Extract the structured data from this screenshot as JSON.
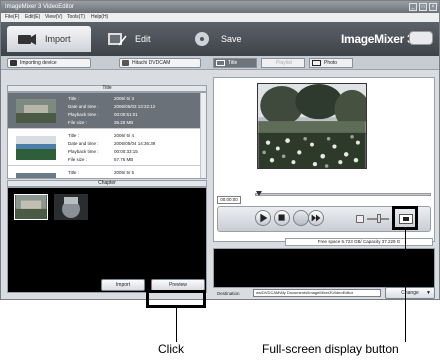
{
  "window": {
    "title": "ImageMixer 3 VideoEditor",
    "menu": [
      "File(F)",
      "Edit(E)",
      "View(V)",
      "Tools(T)",
      "Help(H)"
    ],
    "controls": [
      "minimize",
      "maximize",
      "close"
    ]
  },
  "modes": [
    {
      "label": "Import",
      "icon": "camera-icon",
      "active": true
    },
    {
      "label": "Edit",
      "icon": "film-edit-icon",
      "active": false
    },
    {
      "label": "Save",
      "icon": "disc-icon",
      "active": false
    }
  ],
  "brand": "ImageMixer 3",
  "source_bar": {
    "importing_device_label": "Importing device",
    "device_name": "Hitachi DVDCAM",
    "tabs": [
      {
        "label": "Title",
        "selected": true,
        "enabled": true
      },
      {
        "label": "Playlist",
        "selected": false,
        "enabled": false
      },
      {
        "label": "Photo",
        "selected": false,
        "enabled": true
      }
    ]
  },
  "title_list": {
    "header": "Title",
    "field_labels": [
      "Title :",
      "Date and time :",
      "Playback time :",
      "File size :"
    ],
    "items": [
      {
        "title": "2006/ 5/ 3",
        "datetime": "2006/05/03 13:22:12",
        "playback": "00:00:51:01",
        "size": "39.28 MB",
        "selected": true
      },
      {
        "title": "2006/ 5/ 4",
        "datetime": "2006/05/04 14:36:39",
        "playback": "00:00:33:15",
        "size": "57.76 MB",
        "selected": false
      },
      {
        "title": "2006/ 5/ 5",
        "datetime": "",
        "playback": "",
        "size": "",
        "selected": false
      }
    ]
  },
  "chapter": {
    "header": "Chapter",
    "thumbnail_count": 2
  },
  "buttons": {
    "import": "Import",
    "preview": "Preview",
    "change": "Change"
  },
  "player": {
    "timecode": "00:00:00",
    "controls": [
      "play",
      "stop",
      "record",
      "next"
    ],
    "free_space_label": "Free space",
    "free_space": "Free space 6.723 GB/ Capacity 37.229 G"
  },
  "destination": {
    "label": "Destination",
    "path": "ws\\DVDCAM\\My Documents\\ImageMixer3\\VideoEditor"
  },
  "callouts": {
    "click_label": "Click",
    "fullscreen_label": "Full-screen display button"
  }
}
